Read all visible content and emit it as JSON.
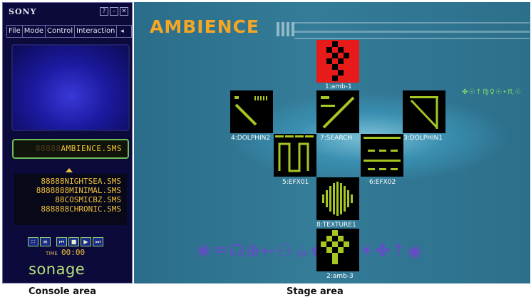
{
  "console": {
    "brand": "SONY",
    "window_buttons": [
      "?",
      "–",
      "✕"
    ],
    "menu": [
      "File",
      "Mode",
      "Control",
      "Interaction"
    ],
    "menu_more": "◂",
    "current_file": "AMBIENCE.SMS",
    "current_file_pad": "88888",
    "playlist": [
      "88888NIGHTSEA.SMS",
      "8888888MINIMAL.SMS",
      "88COSMICBZ.SMS",
      "888888CHRONIC.SMS"
    ],
    "controls": [
      "∷",
      "≡",
      "⏮",
      "■",
      "▶",
      "⏭"
    ],
    "time_label": "TIME",
    "time": "00:00",
    "logo": "sonage"
  },
  "stage": {
    "title": "AMBIENCE",
    "tiles": [
      {
        "label": "1:amb-1"
      },
      {
        "label": "4:DOLPHIN2"
      },
      {
        "label": "7:SEARCH"
      },
      {
        "label": "3:DOLPHIN1"
      },
      {
        "label": "5:EFX01"
      },
      {
        "label": "6:EFX02"
      },
      {
        "label": "8:TEXTURE1"
      },
      {
        "label": "2:amb-3"
      }
    ],
    "symbols_bottom": "❀♒☊⊕←⚇☕✿◐❁☀✤↑◉",
    "symbols_small": "✤☉↑♍♀☉•♏☉"
  },
  "captions": {
    "console": "Console area",
    "stage": "Stage area"
  },
  "colors": {
    "accent_orange": "#f5a623",
    "lcd_yellow": "#f2c23a",
    "tile_green": "#a6c623",
    "tile_red": "#e81b1b",
    "console_bg": "#0b0a3a"
  }
}
